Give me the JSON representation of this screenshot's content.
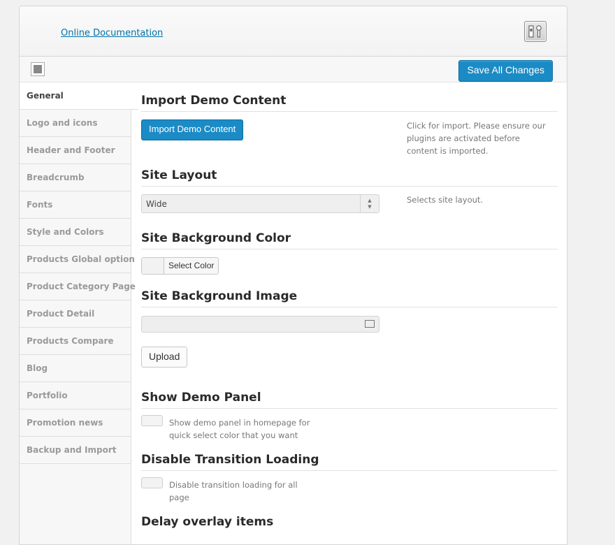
{
  "header": {
    "doc_link": "Online Documentation",
    "logo_icon": "theme-options-icon"
  },
  "toolbar": {
    "save_label": "Save All Changes",
    "expand_icon": "expand-icon"
  },
  "sidebar": {
    "items": [
      {
        "label": "General",
        "active": true
      },
      {
        "label": "Logo and icons"
      },
      {
        "label": "Header and Footer"
      },
      {
        "label": "Breadcrumb"
      },
      {
        "label": "Fonts"
      },
      {
        "label": "Style and Colors"
      },
      {
        "label": "Products Global option"
      },
      {
        "label": "Product Category Page"
      },
      {
        "label": "Product Detail"
      },
      {
        "label": "Products Compare"
      },
      {
        "label": "Blog"
      },
      {
        "label": "Portfolio"
      },
      {
        "label": "Promotion news"
      },
      {
        "label": "Backup and Import"
      }
    ]
  },
  "main": {
    "import": {
      "title": "Import Demo Content",
      "button": "Import Demo Content",
      "desc": "Click for import. Please ensure our plugins are activated before content is imported."
    },
    "layout": {
      "title": "Site Layout",
      "value": "Wide",
      "desc": "Selects site layout."
    },
    "bg_color": {
      "title": "Site Background Color",
      "button": "Select Color"
    },
    "bg_image": {
      "title": "Site Background Image",
      "input_value": "",
      "upload": "Upload"
    },
    "demo_panel": {
      "title": "Show Demo Panel",
      "desc": "Show demo panel in homepage for quick select color that you want"
    },
    "transition": {
      "title": "Disable Transition Loading",
      "desc": "Disable transition loading for all page"
    },
    "overlay": {
      "title": "Delay overlay items"
    }
  },
  "colors": {
    "accent": "#1b8bc6",
    "link": "#0073aa"
  }
}
